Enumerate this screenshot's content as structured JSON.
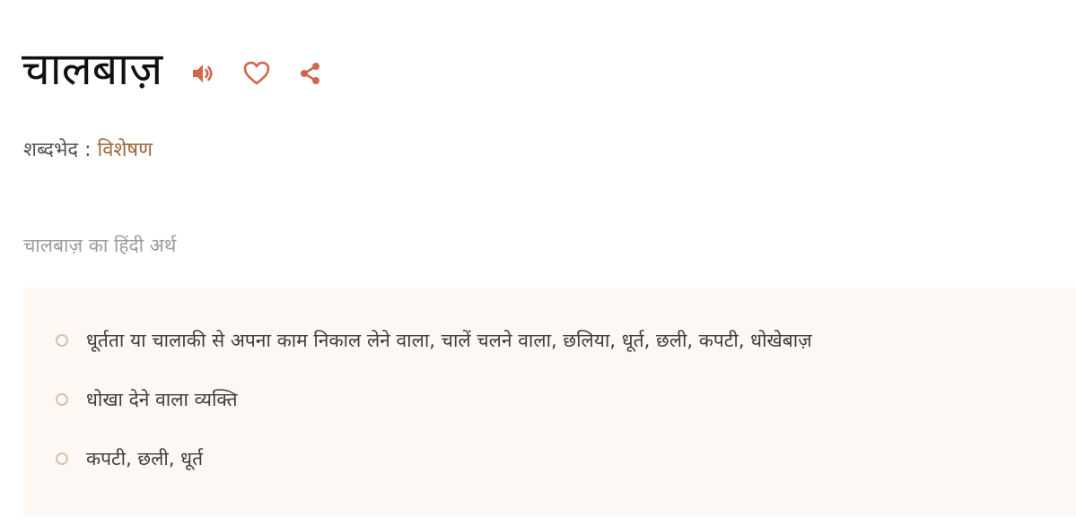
{
  "entry": {
    "headword": "चालबाज़",
    "actions": {
      "icons": [
        "speaker-icon",
        "heart-icon",
        "share-icon"
      ],
      "accent_color": "#d0674c"
    },
    "part_of_speech": {
      "label": "शब्दभेद : ",
      "value": "विशेषण"
    },
    "meaning_heading": "चालबाज़ का हिंदी अर्थ",
    "meanings": [
      "धूर्तता या चालाकी से अपना काम निकाल लेने वाला, चालें चलने वाला, छलिया, धूर्त, छली, कपटी, धोखेबाज़",
      "धोखा देने वाला व्यक्ति",
      "कपटी, छली, धूर्त"
    ]
  }
}
